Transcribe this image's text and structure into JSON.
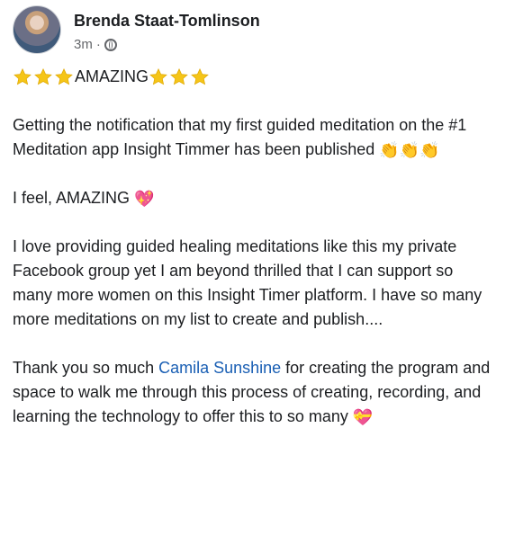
{
  "post": {
    "author_name": "Brenda Staat-Tomlinson",
    "timestamp": "3m",
    "separator": "·",
    "privacy_icon": "globe-icon",
    "emojis": {
      "star": "star-emoji",
      "celebrate": "clapping-hands-emoji",
      "heart": "sparkling-heart-emoji",
      "gift_heart": "heart-with-ribbon-emoji"
    },
    "headline": "AMAZING",
    "p1_text": "Getting the notification that my first guided meditation on the #1 Meditation app Insight Timmer has been published",
    "p2_text": "I feel, AMAZING",
    "p3_text": "I love providing guided healing meditations like this my private Facebook group yet I am beyond thrilled that I can support so many more women on this Insight Timer platform. I have so many more meditations on my list to create and publish....",
    "p4_before": "Thank you so much ",
    "p4_mention": "Camila Sunshine",
    "p4_after": " for creating the program and space to walk me through this process of creating, recording, and learning the technology to offer this to so many"
  },
  "colors": {
    "mention": "#1a5fb4",
    "meta_text": "#65676b",
    "body_text": "#1c1e21",
    "star": "#f5c518"
  }
}
